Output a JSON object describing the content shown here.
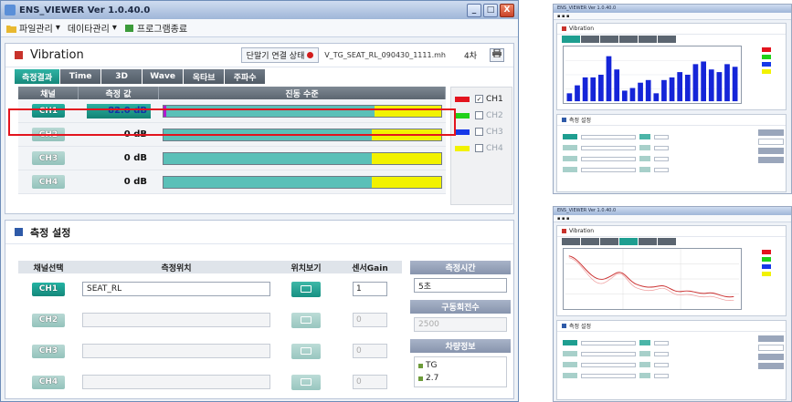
{
  "window": {
    "title": "ENS_VIEWER Ver 1.0.40.0",
    "minimize": "_",
    "maximize": "□",
    "close": "X"
  },
  "menu": [
    "파일관리",
    "데이타관리",
    "프로그램종료"
  ],
  "vibration": {
    "title": "Vibration",
    "status_label": "단말기 연결 상태",
    "status_color": "#d21c1c",
    "filename": "V_TG_SEAT_RL_090430_1111.mh",
    "count": "4차",
    "print_icon": "printer-icon",
    "tabs": [
      "측정결과",
      "Time",
      "3D",
      "Wave",
      "옥타브",
      "주파수"
    ],
    "active_tab": 0,
    "columns": [
      "채널",
      "측정 값",
      "진동 수준"
    ],
    "channels": [
      {
        "name": "CH1",
        "value": "82.0 dB",
        "active": true,
        "level": 0.75
      },
      {
        "name": "CH2",
        "value": "0 dB",
        "active": false,
        "level": 0.75
      },
      {
        "name": "CH3",
        "value": "0 dB",
        "active": false,
        "level": 0.75
      },
      {
        "name": "CH4",
        "value": "0 dB",
        "active": false,
        "level": 0.75
      }
    ],
    "legend": [
      {
        "label": "CH1",
        "color": "#e3141e",
        "checked": true
      },
      {
        "label": "CH2",
        "color": "#21d11a",
        "checked": false
      },
      {
        "label": "CH3",
        "color": "#1638e8",
        "checked": false
      },
      {
        "label": "CH4",
        "color": "#f2f200",
        "checked": false
      }
    ],
    "highlight_color": "#e3141e"
  },
  "settings": {
    "title": "측정 설정",
    "columns": [
      "채널선택",
      "측정위치",
      "위치보기",
      "센서Gain"
    ],
    "rows": [
      {
        "channel": "CH1",
        "location": "SEAT_RL",
        "gain": "1",
        "active": true
      },
      {
        "channel": "CH2",
        "location": "",
        "gain": "0",
        "active": false
      },
      {
        "channel": "CH3",
        "location": "",
        "gain": "0",
        "active": false
      },
      {
        "channel": "CH4",
        "location": "",
        "gain": "0",
        "active": false
      }
    ],
    "side": {
      "time_header": "측정시간",
      "time_value": "5초",
      "rpm_header": "구동회전수",
      "rpm_value": "2500",
      "vehicle_header": "차량정보",
      "vehicle_lines": [
        "TG",
        "2.7"
      ]
    }
  },
  "thumbnails": {
    "top": {
      "title": "ENS_VIEWER Ver 1.0.40.0",
      "panel_title": "Vibration",
      "settings_title": "측정 설정",
      "bar_values": [
        0.15,
        0.3,
        0.45,
        0.45,
        0.5,
        0.85,
        0.6,
        0.2,
        0.25,
        0.35,
        0.4,
        0.15,
        0.4,
        0.45,
        0.55,
        0.5,
        0.7,
        0.75,
        0.6,
        0.55,
        0.7,
        0.65
      ]
    },
    "bottom": {
      "title": "ENS_VIEWER Ver 1.0.40.0",
      "panel_title": "Vibration",
      "settings_title": "측정 설정"
    }
  }
}
